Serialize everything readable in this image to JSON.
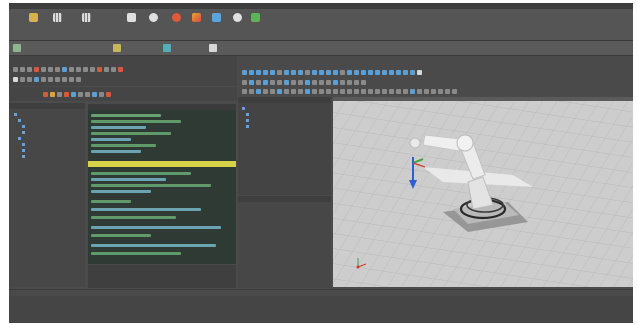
{
  "colors": {
    "app_bg": "#4b4b4b",
    "ribbon_bg": "#555555",
    "panel_bg": "#454545",
    "code_bg": "#2f3a34",
    "code_highlight": "#d7d247",
    "viewport_bg": "#c9c9c9",
    "grid_line": "#b4b4b4",
    "robot_body": "#e6e6e6",
    "axis_x": "#d23a2a",
    "axis_y": "#3da33d",
    "axis_z": "#2c5fd6"
  },
  "ribbon": {
    "buttons": [
      {
        "icon": "folder-icon"
      },
      {
        "icon": "grid-icon"
      },
      {
        "icon": "grid-icon"
      },
      {
        "icon": "table-icon"
      },
      {
        "icon": "gear-icon"
      },
      {
        "icon": "stop-icon"
      },
      {
        "icon": "paint-icon"
      },
      {
        "icon": "network-icon"
      },
      {
        "icon": "info-icon"
      },
      {
        "icon": "play-icon"
      }
    ]
  },
  "tabbar": {
    "tabs": [
      {
        "icon": "document-icon"
      },
      {
        "icon": "robot-icon"
      },
      {
        "icon": "cube-icon"
      },
      {
        "icon": "settings-icon"
      }
    ]
  },
  "viewport": {
    "content": "3d-robot-arm-scene"
  }
}
